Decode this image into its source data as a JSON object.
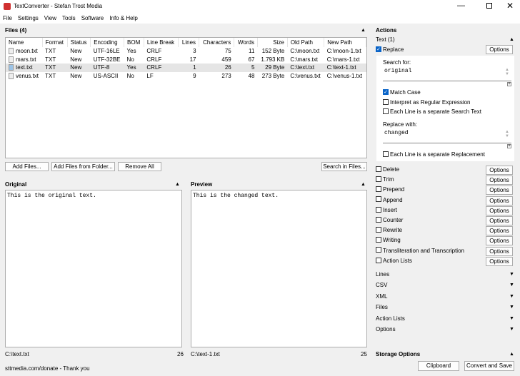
{
  "title": "TextConverter - Stefan Trost Media",
  "menu": [
    "File",
    "Settings",
    "View",
    "Tools",
    "Software",
    "Info & Help"
  ],
  "files": {
    "title": "Files (4)",
    "columns": [
      "Name",
      "Format",
      "Status",
      "Encoding",
      "BOM",
      "Line Break",
      "Lines",
      "Characters",
      "Words",
      "Size",
      "Old Path",
      "New Path"
    ],
    "rows": [
      [
        "moon.txt",
        "TXT",
        "New",
        "UTF-16LE",
        "Yes",
        "CRLF",
        "3",
        "75",
        "11",
        "152 Byte",
        "C:\\moon.txt",
        "C:\\moon-1.txt"
      ],
      [
        "mars.txt",
        "TXT",
        "New",
        "UTF-32BE",
        "No",
        "CRLF",
        "17",
        "459",
        "67",
        "1.793 KB",
        "C:\\mars.txt",
        "C:\\mars-1.txt"
      ],
      [
        "text.txt",
        "TXT",
        "New",
        "UTF-8",
        "Yes",
        "CRLF",
        "1",
        "26",
        "5",
        "29 Byte",
        "C:\\text.txt",
        "C:\\text-1.txt"
      ],
      [
        "venus.txt",
        "TXT",
        "New",
        "US-ASCII",
        "No",
        "LF",
        "9",
        "273",
        "48",
        "273 Byte",
        "C:\\venus.txt",
        "C:\\venus-1.txt"
      ]
    ],
    "selected_row": 2,
    "add_files": "Add Files...",
    "add_folder": "Add Files from Folder...",
    "remove_all": "Remove All",
    "search": "Search in Files..."
  },
  "original": {
    "title": "Original",
    "text": "This is the original text.",
    "path": "C:\\text.txt",
    "count": "26"
  },
  "preview": {
    "title": "Preview",
    "text": "This is the changed text.",
    "path": "C:\\text-1.txt",
    "count": "25"
  },
  "status": "sttmedia.com/donate - Thank you",
  "actions": {
    "title": "Actions",
    "group": "Text (1)",
    "replace": "Replace",
    "options": "Options",
    "search_label": "Search for:",
    "search_value": "original",
    "match_case": "Match Case",
    "regex": "Interpret as Regular Expression",
    "each_line": "Each Line is a separate Search Text",
    "replace_label": "Replace with:",
    "replace_value": "changed",
    "each_repl": "Each Line is a separate Replacement",
    "others": [
      "Delete",
      "Trim",
      "Prepend",
      "Append",
      "Insert",
      "Counter",
      "Rewrite",
      "Writing",
      "Transliteration and Transcription",
      "Action Lists"
    ],
    "sections": [
      "Lines",
      "CSV",
      "XML",
      "Files",
      "Action Lists",
      "Options"
    ]
  },
  "storage": {
    "title": "Storage Options",
    "clipboard": "Clipboard",
    "convert": "Convert and Save"
  }
}
